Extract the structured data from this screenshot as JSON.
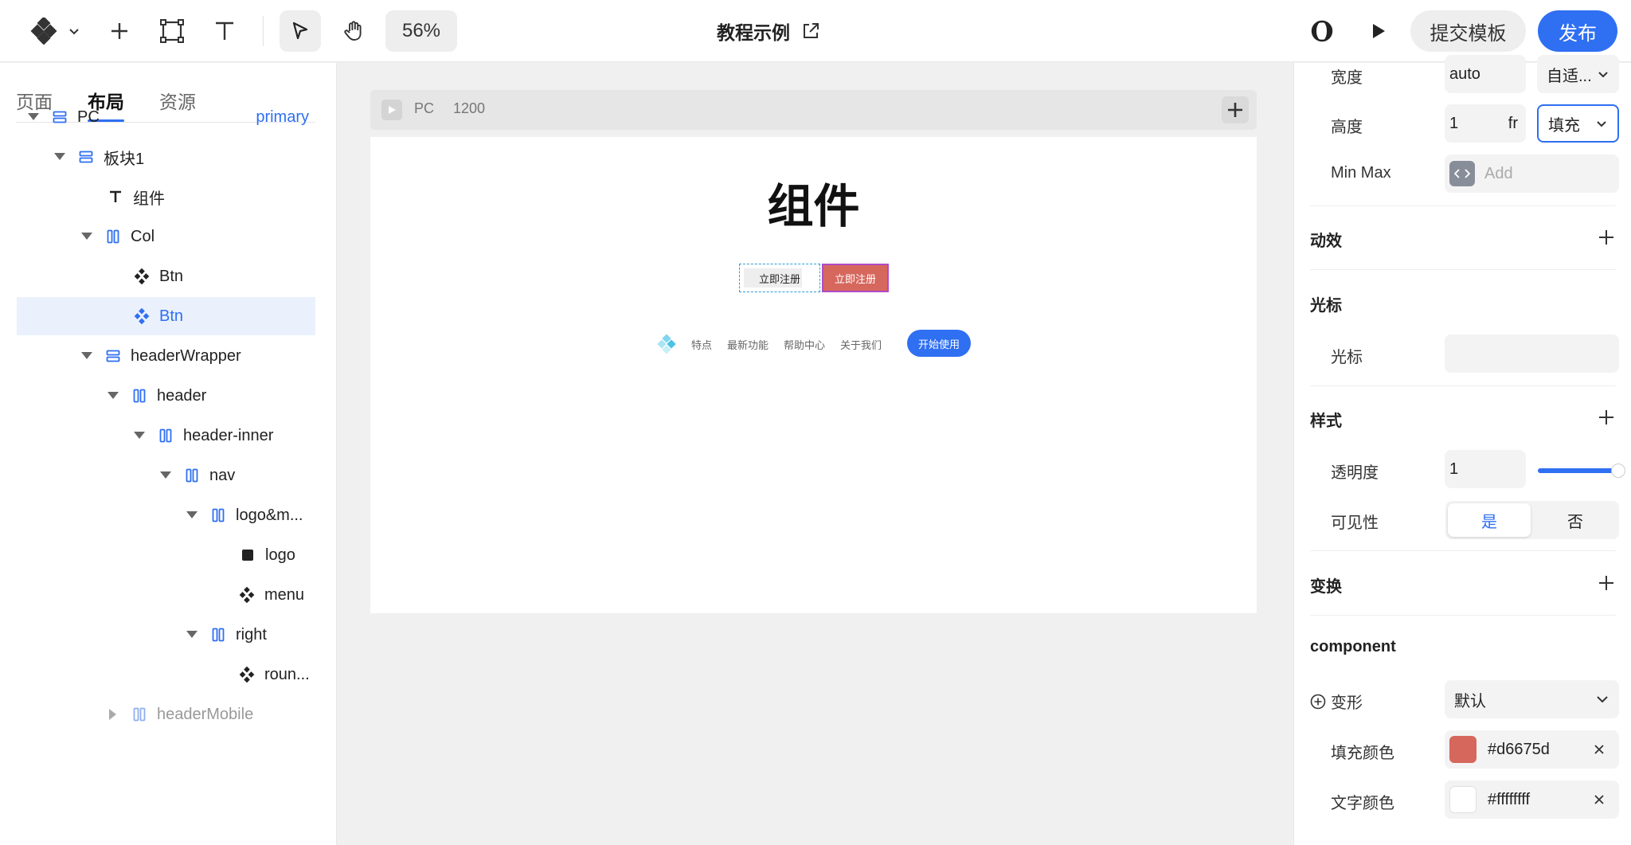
{
  "topbar": {
    "zoom": "56%",
    "doc_title": "教程示例",
    "submit_template": "提交模板",
    "publish": "发布"
  },
  "left_panel": {
    "tabs": [
      {
        "label": "页面",
        "active": false
      },
      {
        "label": "布局",
        "active": true
      },
      {
        "label": "资源",
        "active": false
      }
    ],
    "tree": [
      {
        "label": "PC",
        "badge": "primary"
      },
      {
        "label": "板块1"
      },
      {
        "label": "组件"
      },
      {
        "label": "Col"
      },
      {
        "label": "Btn"
      },
      {
        "label": "Btn",
        "selected": true
      },
      {
        "label": "headerWrapper"
      },
      {
        "label": "header"
      },
      {
        "label": "header-inner"
      },
      {
        "label": "nav"
      },
      {
        "label": "logo&m..."
      },
      {
        "label": "logo"
      },
      {
        "label": "menu"
      },
      {
        "label": "right"
      },
      {
        "label": "roun..."
      },
      {
        "label": "headerMobile"
      }
    ]
  },
  "canvas": {
    "breakpoint": "PC",
    "width": "1200",
    "title": "组件",
    "button_primary": "立即注册",
    "button_secondary": "立即注册",
    "nav_links": [
      "特点",
      "最新功能",
      "帮助中心",
      "关于我们"
    ],
    "cta": "开始使用"
  },
  "right_panel": {
    "width_label": "宽度",
    "width_value": "auto",
    "width_mode": "自适...",
    "height_label": "高度",
    "height_value": "1",
    "height_unit": "fr",
    "height_mode": "填充",
    "minmax_label": "Min Max",
    "minmax_placeholder": "Add",
    "motion_section": "动效",
    "cursor_section": "光标",
    "cursor_label": "光标",
    "style_section": "样式",
    "opacity_label": "透明度",
    "opacity_value": "1",
    "opacity_level": 1,
    "visibility_label": "可见性",
    "visibility_yes": "是",
    "visibility_no": "否",
    "transform_section": "变换",
    "component_section": "component",
    "variant_label": "变形",
    "variant_value": "默认",
    "fill_color_label": "填充颜色",
    "fill_color": "#d6675d",
    "text_color_label": "文字颜色",
    "text_color": "#ffffffff"
  }
}
